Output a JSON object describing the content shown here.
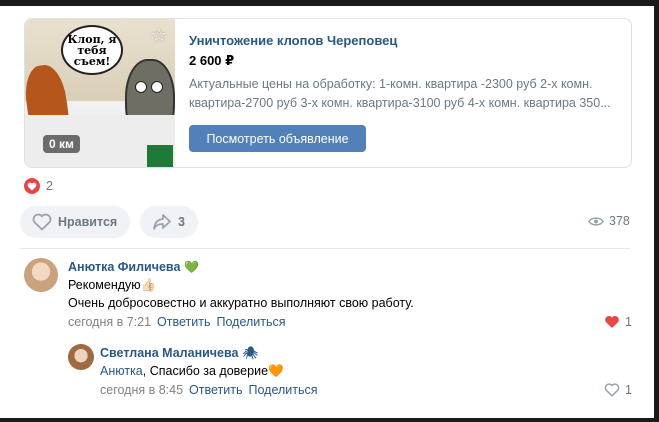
{
  "ad": {
    "image_badge": "0 км",
    "image_bubble": "Клоп, я тебя съем!",
    "title": "Уничтожение клопов Череповец",
    "price": "2 600 ₽",
    "description_line1": "Актуальные цены на обработку: 1-комн. квартира -2300 руб 2-х комн.",
    "description_line2": "квартира-2700 руб 3-х комн. квартира-3100 руб 4-х комн. квартира 350...",
    "button_label": "Посмотреть объявление",
    "favorite_icon": "star-icon"
  },
  "post_stats": {
    "reactions_count": "2",
    "like_label": "Нравится",
    "share_count": "3",
    "views_count": "378"
  },
  "comments": [
    {
      "author": "Анютка Филичева",
      "author_emoji": "💚",
      "line1": "Рекомендую👍🏻",
      "line2": "Очень добросовестно и аккуратно выполняют свою работу.",
      "time": "сегодня в 7:21",
      "reply_label": "Ответить",
      "share_label": "Поделиться",
      "likes": "1"
    },
    {
      "author": "Светлана Маланичева",
      "author_emoji": "🕷",
      "reply_to": "Анютка",
      "text": ", Спасибо за доверие🧡",
      "time": "сегодня в 8:45",
      "reply_label": "Ответить",
      "share_label": "Поделиться",
      "likes": "1"
    }
  ],
  "colors": {
    "link": "#2a5885",
    "button": "#5181b8",
    "heart": "#e64646",
    "muted": "#6d7885"
  }
}
